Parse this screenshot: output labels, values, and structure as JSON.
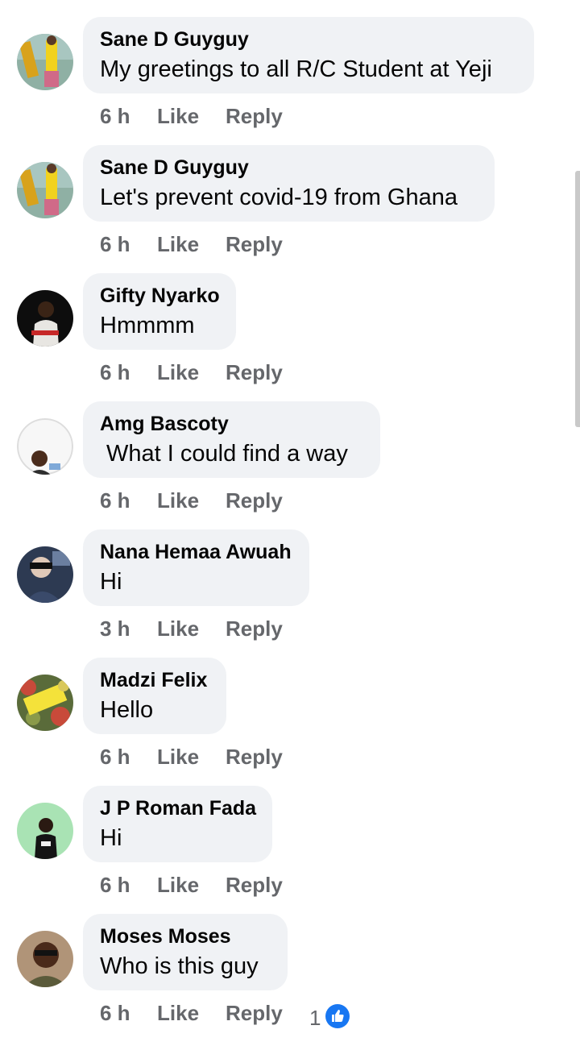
{
  "comments": [
    {
      "author": "Sane D Guyguy",
      "text": "My greetings to all R/C Student at Yeji",
      "time": "6 h",
      "like": "Like",
      "reply": "Reply"
    },
    {
      "author": "Sane D Guyguy",
      "text": "Let's prevent covid-19 from Ghana",
      "time": "6 h",
      "like": "Like",
      "reply": "Reply"
    },
    {
      "author": "Gifty Nyarko",
      "text": "Hmmmm",
      "time": "6 h",
      "like": "Like",
      "reply": "Reply"
    },
    {
      "author": "Amg Bascoty",
      "text": " What I could find a way",
      "time": "6 h",
      "like": "Like",
      "reply": "Reply"
    },
    {
      "author": "Nana Hemaa Awuah",
      "text": "Hi",
      "time": "3 h",
      "like": "Like",
      "reply": "Reply"
    },
    {
      "author": "Madzi Felix",
      "text": "Hello",
      "time": "6 h",
      "like": "Like",
      "reply": "Reply"
    },
    {
      "author": "J P Roman Fada",
      "text": "Hi",
      "time": "6 h",
      "like": "Like",
      "reply": "Reply"
    },
    {
      "author": "Moses Moses",
      "text": "Who is this guy",
      "time": "6 h",
      "like": "Like",
      "reply": "Reply",
      "reaction_count": "1",
      "reaction_icon": "like-reaction-icon"
    }
  ],
  "colors": {
    "bubble": "#f0f2f5",
    "text": "#050505",
    "meta": "#65676b",
    "like_blue": "#1877f2"
  }
}
